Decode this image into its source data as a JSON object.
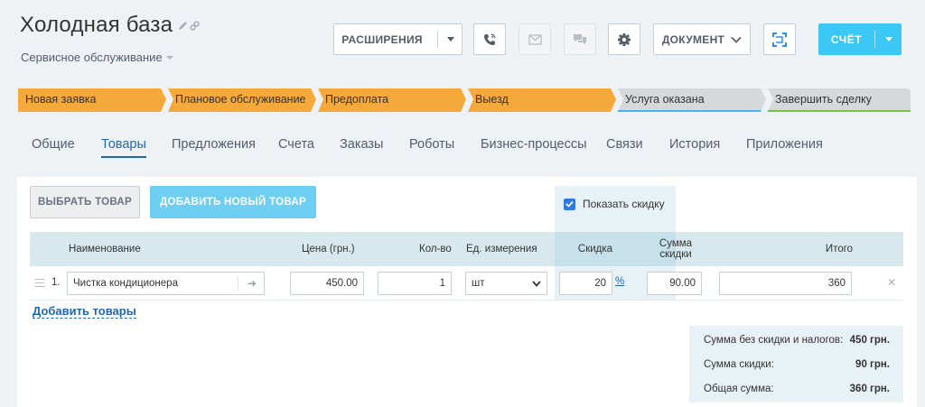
{
  "header": {
    "title": "Холодная база",
    "subtitle": "Сервисное обслуживание",
    "extensions_label": "РАСШИРЕНИЯ",
    "document_label": "ДОКУМЕНТ",
    "invoice_label": "СЧЁТ"
  },
  "stages": [
    {
      "label": "Новая заявка",
      "color": "#f5a93b"
    },
    {
      "label": "Плановое обслуживание",
      "color": "#f5a93b"
    },
    {
      "label": "Предоплата",
      "color": "#f5a93b"
    },
    {
      "label": "Выезд",
      "color": "#f5a93b"
    },
    {
      "label": "Услуга оказана",
      "color": "#d5d9dc",
      "accent": "#4ab5e9"
    },
    {
      "label": "Завершить сделку",
      "color": "#d5d9dc",
      "accent": "#7bc143"
    }
  ],
  "tabs": [
    "Общие",
    "Товары",
    "Предложения",
    "Счета",
    "Заказы",
    "Роботы",
    "Бизнес-процессы",
    "Связи",
    "История",
    "Приложения"
  ],
  "active_tab": "Товары",
  "products": {
    "choose_label": "ВЫБРАТЬ ТОВАР",
    "add_new_label": "ДОБАВИТЬ НОВЫЙ ТОВАР",
    "show_discount_label": "Показать скидку",
    "columns": {
      "name": "Наименование",
      "price": "Цена (грн.)",
      "qty": "Кол-во",
      "unit": "Ед. измерения",
      "discount": "Скидка",
      "discount_sum_line1": "Сумма",
      "discount_sum_line2": "скидки",
      "total": "Итого"
    },
    "rows": [
      {
        "num": "1.",
        "name": "Чистка кондиционера",
        "price": "450.00",
        "qty": "1",
        "unit": "шт",
        "discount": "20",
        "discount_unit": "%",
        "discount_sum": "90.00",
        "total": "360"
      }
    ],
    "add_goods_label": "Добавить товары"
  },
  "totals": {
    "without_discount_label": "Сумма без скидки и налогов:",
    "without_discount_value": "450 грн.",
    "discount_label": "Сумма скидки:",
    "discount_value": "90 грн.",
    "total_label": "Общая сумма:",
    "total_value": "360 грн."
  },
  "colors": {
    "accent_blue": "#3bc8f5",
    "link_blue": "#2067b0",
    "stage_active": "#f5a93b"
  }
}
